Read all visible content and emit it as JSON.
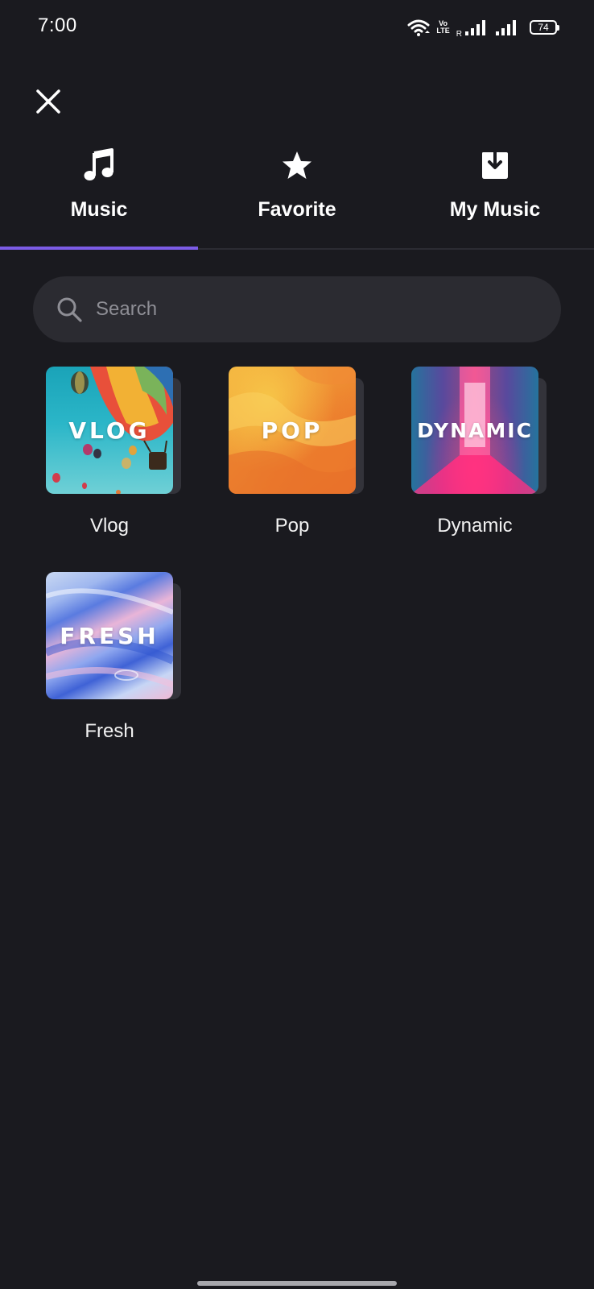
{
  "status_bar": {
    "time": "7:00",
    "volte_top": "Vo",
    "volte_bottom": "LTE",
    "roaming": "R",
    "battery": "74"
  },
  "tabs": [
    {
      "label": "Music",
      "icon": "music-note-icon",
      "active": true
    },
    {
      "label": "Favorite",
      "icon": "star-icon",
      "active": false
    },
    {
      "label": "My Music",
      "icon": "download-icon",
      "active": false
    }
  ],
  "search": {
    "placeholder": "Search"
  },
  "categories": [
    {
      "label": "Vlog",
      "cover_text": "VLOG"
    },
    {
      "label": "Pop",
      "cover_text": "POP"
    },
    {
      "label": "Dynamic",
      "cover_text": "DYNAMIC"
    },
    {
      "label": "Fresh",
      "cover_text": "FRESH"
    }
  ],
  "colors": {
    "background": "#1a1a1f",
    "accent": "#7c5ce6",
    "search_bg": "#2b2b31",
    "placeholder": "#8e8e95"
  }
}
